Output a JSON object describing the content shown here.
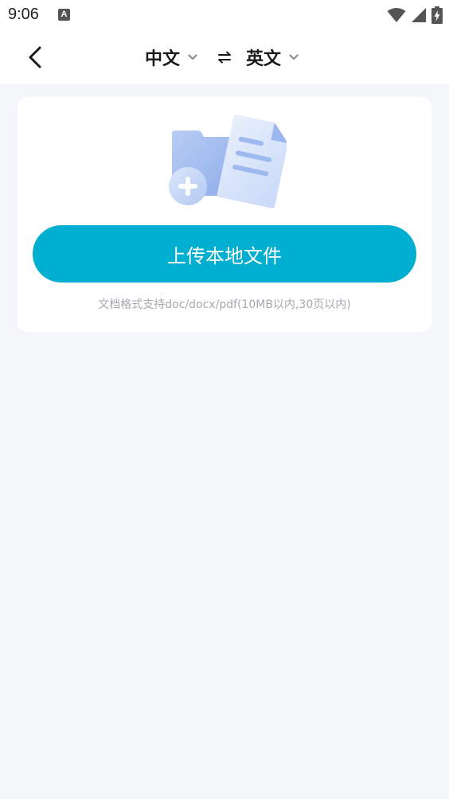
{
  "status_bar": {
    "time": "9:06",
    "app_icon_letter": "A",
    "icons": [
      "wifi-icon",
      "signal-icon",
      "battery-charging-icon"
    ]
  },
  "toolbar": {
    "back_icon": "chevron-left-icon",
    "source_language": "中文",
    "target_language": "英文",
    "swap_icon": "swap-icon",
    "dropdown_icon": "chevron-down-icon"
  },
  "upload_card": {
    "illustration": "document-folder-add-icon",
    "button_label": "上传本地文件",
    "hint": "文档格式支持doc/docx/pdf(10MB以内,30页以内)"
  },
  "colors": {
    "accent": "#00aecf",
    "page_background": "#f5f6f9",
    "card_background": "#ffffff",
    "hint_text": "#a6a8ad"
  }
}
